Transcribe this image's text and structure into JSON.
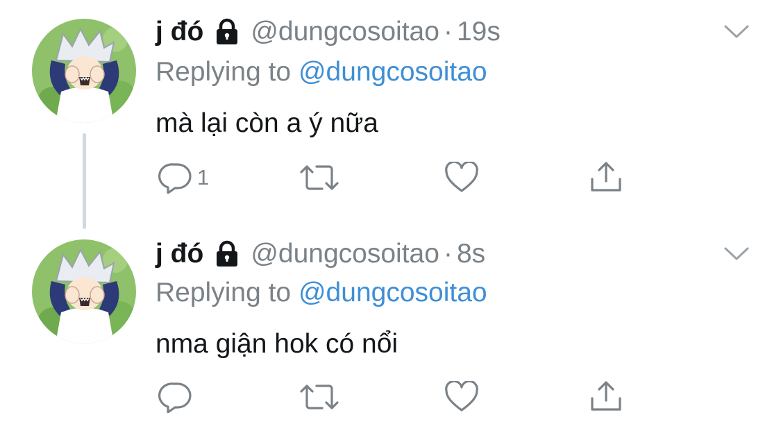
{
  "tweets": [
    {
      "display_name": "j đó",
      "handle": "@dungcosoitao",
      "separator": "·",
      "time": "19s",
      "replying_prefix": "Replying to",
      "replying_to": "@dungcosoitao",
      "text": "mà lại còn a ý nữa",
      "reply_count": "1"
    },
    {
      "display_name": "j đó",
      "handle": "@dungcosoitao",
      "separator": "·",
      "time": "8s",
      "replying_prefix": "Replying to",
      "replying_to": "@dungcosoitao",
      "text": "nma giận hok có nổi",
      "reply_count": ""
    }
  ],
  "icons": {
    "lock": "lock-icon",
    "caret": "chevron-down-icon",
    "reply": "reply-icon",
    "retweet": "retweet-icon",
    "like": "heart-icon",
    "share": "share-icon"
  },
  "colors": {
    "text": "#14171a",
    "secondary": "#7a8288",
    "link": "#3f8fd6",
    "thread_line": "#cfd9de"
  }
}
